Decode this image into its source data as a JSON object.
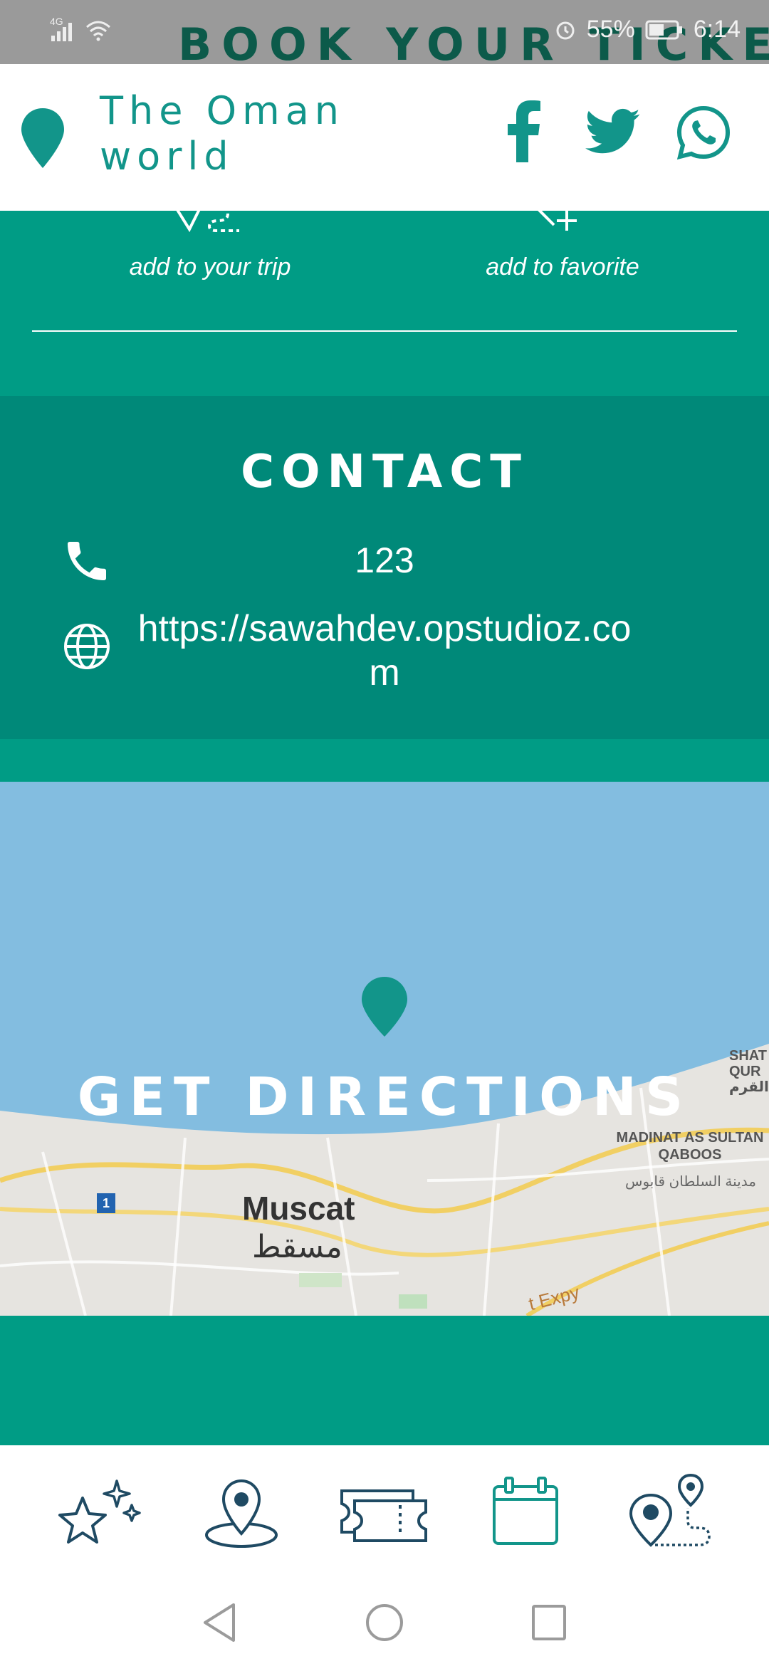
{
  "status_bar": {
    "network": "4G",
    "battery": "55%",
    "time": "6:14",
    "peek_text": "BOOK YOUR TICKET"
  },
  "header": {
    "title": "The Oman world",
    "social": [
      "facebook-icon",
      "twitter-icon",
      "whatsapp-icon"
    ]
  },
  "actions": {
    "add_trip": "add to your trip",
    "add_favorite": "add to favorite"
  },
  "contact": {
    "title": "CONTACT",
    "phone": "123",
    "website": "https://sawahdev.opstudioz.com"
  },
  "map": {
    "cta": "GET DIRECTIONS",
    "city": "Muscat",
    "city_ar": "مسقط",
    "district": "MADINAT AS SULTAN QABOOS",
    "district_ar": "مدينة السلطان قابوس",
    "shatti": "SHAT QUR",
    "shatti_ar": "القرم",
    "road_shield": "1",
    "expy": "t Expy"
  },
  "bottom_nav": [
    "stars-icon",
    "location-icon",
    "tickets-icon",
    "calendar-icon",
    "route-icon"
  ],
  "colors": {
    "primary": "#009C85",
    "primary_dark": "#008979",
    "header_text": "#12958a",
    "nav_icon": "#1f4a63"
  }
}
